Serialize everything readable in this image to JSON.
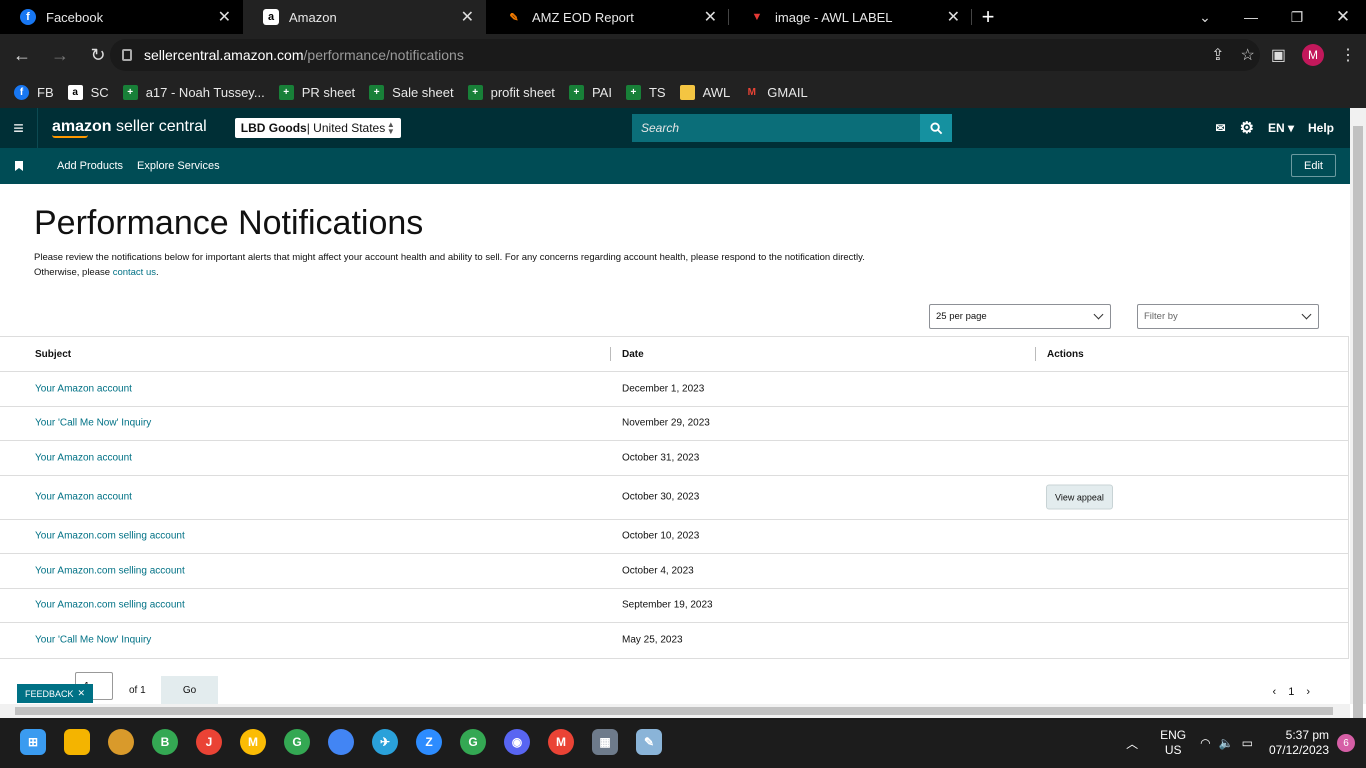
{
  "browser": {
    "tabs": [
      {
        "title": "Facebook",
        "icon": "facebook-icon",
        "color": "#1877f2",
        "glyph": "f"
      },
      {
        "title": "Amazon",
        "icon": "amazon-icon",
        "color": "#ffffff",
        "glyph": "a"
      },
      {
        "title": "AMZ EOD Report",
        "icon": "report-icon",
        "color": "#f57c00",
        "glyph": "✎"
      },
      {
        "title": "image - AWL LABEL",
        "icon": "label-icon",
        "color": "#e53935",
        "glyph": "▼"
      }
    ],
    "url_host": "sellercentral.amazon.com",
    "url_path": "/performance/notifications",
    "profile_initial": "M",
    "bookmarks": [
      {
        "label": "FB",
        "icon": "facebook-icon",
        "color": "#1877f2",
        "glyph": "f"
      },
      {
        "label": "SC",
        "icon": "amazon-icon",
        "color": "#222222",
        "glyph": "a"
      },
      {
        "label": "a17 - Noah Tussey...",
        "icon": "sheets-icon",
        "color": "#188038",
        "glyph": "+"
      },
      {
        "label": "PR sheet",
        "icon": "sheets-icon",
        "color": "#188038",
        "glyph": "+"
      },
      {
        "label": "Sale sheet",
        "icon": "sheets-icon",
        "color": "#188038",
        "glyph": "+"
      },
      {
        "label": "profit sheet",
        "icon": "sheets-icon",
        "color": "#188038",
        "glyph": "+"
      },
      {
        "label": "PAI",
        "icon": "sheets-icon",
        "color": "#188038",
        "glyph": "+"
      },
      {
        "label": "TS",
        "icon": "sheets-icon",
        "color": "#188038",
        "glyph": "+"
      },
      {
        "label": "AWL",
        "icon": "folder-icon",
        "color": "#f4c542",
        "glyph": ""
      },
      {
        "label": "GMAIL",
        "icon": "gmail-icon",
        "color": "#222222",
        "glyph": "M"
      }
    ]
  },
  "header": {
    "logo_main": "amazon",
    "logo_sub": " seller central",
    "store_name": "LBD Goods",
    "store_region": " | United States",
    "search_placeholder": "Search",
    "language": "EN",
    "help": "Help"
  },
  "subnav": {
    "links": [
      "Add Products",
      "Explore Services"
    ],
    "edit": "Edit"
  },
  "page": {
    "title": "Performance Notifications",
    "intro_text": "Please review the notifications below for important alerts that might affect your account health and ability to sell. For any concerns regarding account health, please respond to the notification directly. Otherwise, please ",
    "intro_link": "contact us",
    "intro_end": ".",
    "per_page": "25 per page",
    "filter_placeholder": "Filter by"
  },
  "table": {
    "headers": {
      "subject": "Subject",
      "date": "Date",
      "actions": "Actions"
    },
    "rows": [
      {
        "subject": "Your Amazon account",
        "date": "December 1, 2023",
        "action": ""
      },
      {
        "subject": "Your 'Call Me Now' Inquiry",
        "date": "November 29, 2023",
        "action": ""
      },
      {
        "subject": "Your Amazon account",
        "date": "October 31, 2023",
        "action": ""
      },
      {
        "subject": "Your Amazon account",
        "date": "October 30, 2023",
        "action": "View appeal"
      },
      {
        "subject": "Your Amazon.com selling account",
        "date": "October 10, 2023",
        "action": ""
      },
      {
        "subject": "Your Amazon.com selling account",
        "date": "October 4, 2023",
        "action": ""
      },
      {
        "subject": "Your Amazon.com selling account",
        "date": "September 19, 2023",
        "action": ""
      },
      {
        "subject": "Your 'Call Me Now' Inquiry",
        "date": "May 25, 2023",
        "action": ""
      }
    ]
  },
  "pagination": {
    "feedback": "FEEDBACK",
    "current_page": "1",
    "of_text": "of 1",
    "go": "Go",
    "page_number": "1"
  },
  "taskbar": {
    "language": "ENG",
    "region": "US",
    "time": "5:37 pm",
    "date": "07/12/2023",
    "notifications": "6",
    "apps": [
      {
        "name": "windows-start-icon",
        "color": "#3a9bf0",
        "glyph": "⊞"
      },
      {
        "name": "file-explorer-icon",
        "color": "#f4b400",
        "glyph": ""
      },
      {
        "name": "app-icon",
        "color": "#d99a2b",
        "glyph": ""
      },
      {
        "name": "chrome-icon",
        "color": "#34a853",
        "glyph": "B"
      },
      {
        "name": "chrome-icon",
        "color": "#ea4335",
        "glyph": "J"
      },
      {
        "name": "chrome-icon",
        "color": "#fbbc05",
        "glyph": "M"
      },
      {
        "name": "chrome-icon",
        "color": "#34a853",
        "glyph": "G"
      },
      {
        "name": "chrome-icon",
        "color": "#4285f4",
        "glyph": ""
      },
      {
        "name": "telegram-icon",
        "color": "#2aa1da",
        "glyph": "✈"
      },
      {
        "name": "zoom-icon",
        "color": "#2d8cff",
        "glyph": "Z"
      },
      {
        "name": "chrome-icon",
        "color": "#34a853",
        "glyph": "G"
      },
      {
        "name": "discord-icon",
        "color": "#5865f2",
        "glyph": "◉"
      },
      {
        "name": "chrome-icon",
        "color": "#ea4335",
        "glyph": "M"
      },
      {
        "name": "calculator-icon",
        "color": "#6e7b8b",
        "glyph": "▦"
      },
      {
        "name": "notepad-icon",
        "color": "#8ab4d8",
        "glyph": "✎"
      }
    ]
  },
  "colors": {
    "amazon_dark": "#002f36",
    "amazon_sub": "#004c55",
    "link": "#007185",
    "search_bg": "#0b6e79"
  }
}
